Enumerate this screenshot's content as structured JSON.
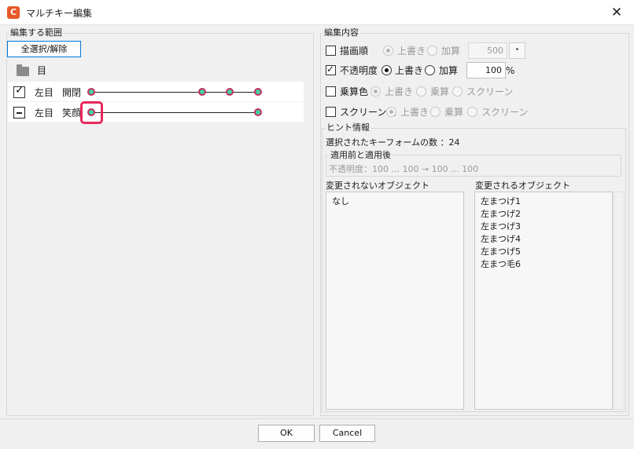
{
  "window": {
    "title": "マルチキー編集",
    "close": "✕"
  },
  "left": {
    "group_label": "編集する範囲",
    "select_button": "全選択/解除",
    "folder_label": "目",
    "rows": [
      {
        "col1": "左目",
        "col2": "開閉"
      },
      {
        "col1": "左目",
        "col2": "笑顔"
      }
    ]
  },
  "right": {
    "group_label": "編集内容",
    "draw_order": {
      "label": "描画順",
      "opt1": "上書き",
      "opt2": "加算",
      "value": "500",
      "btn": "•"
    },
    "opacity": {
      "label": "不透明度",
      "opt1": "上書き",
      "opt2": "加算",
      "value": "100",
      "unit": "%"
    },
    "multiply": {
      "label": "乗算色",
      "opt1": "上書き",
      "opt2": "乗算",
      "opt3": "スクリーン"
    },
    "screen": {
      "label": "スクリーン色",
      "opt1": "上書き",
      "opt2": "乗算",
      "opt3": "スクリーン"
    },
    "hint": {
      "group_label": "ヒント情報",
      "count_text": "選択されたキーフォームの数 ：24",
      "before_after_label": "適用前と適用後",
      "before_after_text": "不透明度：100 ... 100 → 100 ... 100"
    },
    "unchanged": {
      "header": "変更されないオブジェクト",
      "items": [
        "なし"
      ]
    },
    "changed": {
      "header": "変更されるオブジェクト",
      "items": [
        "左まつげ1",
        "左まつげ2",
        "左まつげ3",
        "左まつげ4",
        "左まつげ5",
        "左まつ毛6"
      ]
    }
  },
  "buttons": {
    "ok": "OK",
    "cancel": "Cancel"
  },
  "colors": {
    "accent": "#e8582a",
    "keyform_fill": "#3fd1a2",
    "keyform_border": "#c53060",
    "highlight": "#e8285a"
  }
}
